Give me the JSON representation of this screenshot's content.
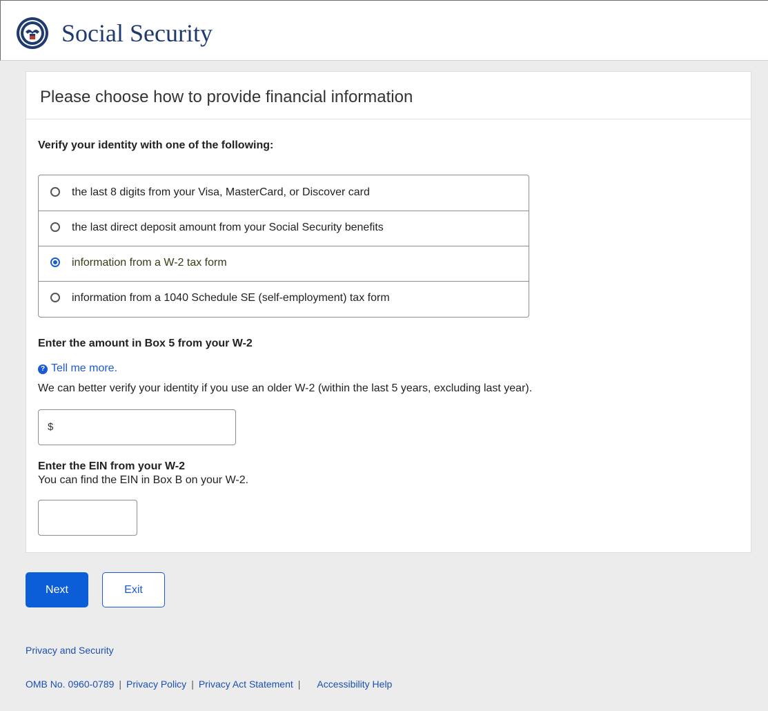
{
  "header": {
    "brand": "Social Security",
    "logo_icon": "ssa-seal-icon"
  },
  "card": {
    "title": "Please choose how to provide financial information",
    "verify_label": "Verify your identity with one of the following:",
    "options": [
      {
        "label": "the last 8 digits from your Visa, MasterCard, or Discover card",
        "checked": false
      },
      {
        "label": "the last direct deposit amount from your Social Security benefits",
        "checked": false
      },
      {
        "label": "information from a W-2 tax form",
        "checked": true
      },
      {
        "label": "information from a 1040 Schedule SE (self-employment) tax form",
        "checked": false
      }
    ],
    "box5_label": "Enter the amount in Box 5 from your W-2",
    "tell_more": "Tell me more.",
    "hint": "We can better verify your identity if you use an older W-2 (within the last 5 years, excluding last year).",
    "amount_prefix": "$",
    "amount_value": "",
    "ein_label": "Enter the EIN from your W-2",
    "ein_hint": "You can find the EIN in Box B on your W-2.",
    "ein_value": ""
  },
  "buttons": {
    "next": "Next",
    "exit": "Exit"
  },
  "footer": {
    "privacy_security": "Privacy and Security",
    "omb": "OMB No. 0960-0789",
    "privacy_policy": "Privacy Policy",
    "privacy_act": "Privacy Act Statement",
    "accessibility": "Accessibility Help",
    "separator": "|"
  },
  "colors": {
    "accent": "#1a5ad7",
    "brand_text": "#1f3a6e",
    "page_bg": "#ececec"
  }
}
